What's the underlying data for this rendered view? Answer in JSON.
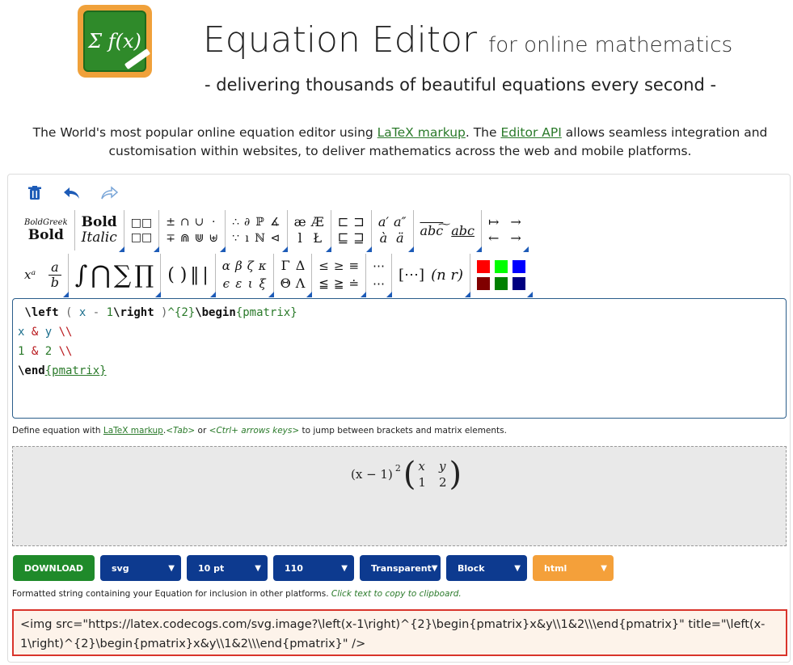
{
  "header": {
    "logo_text": "Σ f(x)",
    "title": "Equation Editor",
    "title_sub": "for online mathematics",
    "tagline": "- delivering thousands of beautiful equations every second -"
  },
  "intro": {
    "text1": "The World's most popular online equation editor using ",
    "link1": "LaTeX markup",
    "text2": ". The ",
    "link2": "Editor API",
    "text3": " allows seamless integration and customisation within websites, to deliver mathematics across the web and mobile platforms."
  },
  "toolbar": {
    "icons": [
      "trash-icon",
      "undo-icon",
      "redo-icon"
    ]
  },
  "palette": {
    "row1": [
      {
        "name": "font-style-group-1",
        "items": [
          "BoldGreek",
          "Bold"
        ]
      },
      {
        "name": "font-style-group-2",
        "items": [
          "Bold",
          "Italic"
        ]
      },
      {
        "name": "boxes-group",
        "items": [
          "□□",
          "□□"
        ]
      },
      {
        "name": "operators-group",
        "items": [
          "±",
          "∩",
          "∪",
          "·",
          "∓",
          "⋒",
          "⋓",
          "⊎"
        ]
      },
      {
        "name": "logic-group",
        "items": [
          "∴",
          "∂",
          "ℙ",
          "∡",
          "∵",
          "ı",
          "ℕ",
          "⊲"
        ]
      },
      {
        "name": "letters-group",
        "items": [
          "æ",
          "Æ",
          "l",
          "Ł"
        ]
      },
      {
        "name": "subset-group",
        "items": [
          "⊏",
          "⊐",
          "⊑",
          "⊒"
        ]
      },
      {
        "name": "accents-group",
        "items": [
          "a′",
          "a″",
          "à",
          "ä"
        ]
      },
      {
        "name": "wide-accents-group",
        "items": [
          "abc͠",
          "abc"
        ]
      },
      {
        "name": "arrows-group",
        "items": [
          "↦",
          "→",
          "←",
          "→"
        ]
      }
    ],
    "row2": [
      {
        "name": "superscript-group",
        "items": [
          "xᵃ"
        ]
      },
      {
        "name": "fraction-group",
        "items": [
          "a",
          "b"
        ]
      },
      {
        "name": "integral-group",
        "items": [
          "∫",
          "⋂",
          "∑",
          "∏"
        ]
      },
      {
        "name": "brackets-group",
        "items": [
          "( )",
          "‖",
          "|"
        ]
      },
      {
        "name": "greek-lower-group",
        "items": [
          "α",
          "β",
          "ζ",
          "κ",
          "ϵ",
          "ε",
          "ι",
          "ξ"
        ]
      },
      {
        "name": "greek-upper-group",
        "items": [
          "Γ",
          "Δ",
          "Θ",
          "Λ"
        ]
      },
      {
        "name": "relations-group",
        "items": [
          "≤",
          "≥",
          "≡",
          "≦",
          "≧",
          "≐"
        ]
      },
      {
        "name": "dots-group",
        "items": [
          "⋯",
          "⋯"
        ]
      },
      {
        "name": "matrix-group",
        "items": [
          "[⋯]",
          "(n r)"
        ]
      }
    ],
    "colors": [
      "#ff0000",
      "#00ff00",
      "#0000ff",
      "#800000",
      "#008000",
      "#000080"
    ]
  },
  "code": {
    "line1": {
      "cmd1": " \\left",
      "p1": " ( ",
      "v1": "x",
      "p2": " - ",
      "n1": "1",
      "cmd2": "\\right",
      "p3": " )",
      "rest": "^{2}",
      "cmd3": "\\begin",
      "brace": "{pmatrix}"
    },
    "line2": {
      "v1": "x",
      "amp": " & ",
      "v2": "y",
      "nl": " \\\\"
    },
    "line3": {
      "n1": "1",
      "amp": " & ",
      "n2": "2",
      "nl": " \\\\"
    },
    "line4": {
      "cmd": "\\end",
      "brace": "{pmatrix}"
    }
  },
  "hint": {
    "text1": "Define equation with ",
    "link": "LaTeX markup",
    "text2": ".",
    "tab": "<Tab>",
    "text3": " or ",
    "ctrl": "<Ctrl+ arrows keys>",
    "text4": " to jump between brackets and matrix elements."
  },
  "preview": {
    "base": "(x − 1)",
    "exp": "2",
    "m11": "x",
    "m12": "y",
    "m21": "1",
    "m22": "2"
  },
  "controls": {
    "download": "DOWNLOAD",
    "format": "svg",
    "size": "10 pt",
    "dpi": "110",
    "background": "Transparent",
    "display": "Block",
    "output": "html"
  },
  "format_hint": {
    "text": "Formatted string containing your Equation for inclusion in other platforms. ",
    "action": "Click text to copy to clipboard."
  },
  "output": {
    "html": "<img src=\"https://latex.codecogs.com/svg.image?\\left(x-1\\right)^{2}\\begin{pmatrix}x&y\\\\1&2\\\\\\end{pmatrix}\" title=\"\\left(x-1\\right)^{2}\\begin{pmatrix}x&y\\\\1&2\\\\\\end{pmatrix}\" />"
  }
}
